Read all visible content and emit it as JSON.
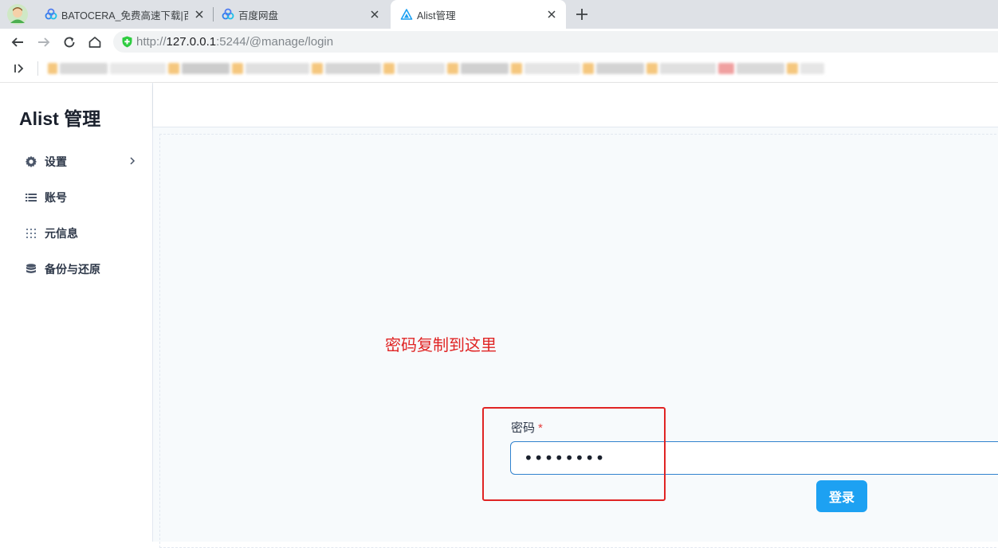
{
  "browser": {
    "tabs": [
      {
        "title": "BATOCERA_免费高速下载|百度",
        "icon": "baidu-netdisk-icon"
      },
      {
        "title": "百度网盘",
        "icon": "baidu-netdisk-icon"
      },
      {
        "title": "Alist管理",
        "icon": "alist-logo-icon"
      }
    ],
    "active_tab_index": 2,
    "url": {
      "scheme": "http://",
      "host": "127.0.0.1",
      "rest": ":5244/@manage/login"
    }
  },
  "sidebar": {
    "title": "Alist 管理",
    "items": [
      {
        "label": "设置",
        "icon": "gear-icon",
        "has_submenu": true
      },
      {
        "label": "账号",
        "icon": "list-icon"
      },
      {
        "label": "元信息",
        "icon": "grid-icon"
      },
      {
        "label": "备份与还原",
        "icon": "database-icon"
      }
    ]
  },
  "annotation": {
    "text": "密码复制到这里",
    "color": "#e02424"
  },
  "login": {
    "password_label": "密码",
    "required_mark": "*",
    "password_value": "••••••••",
    "submit_label": "登录"
  },
  "colors": {
    "accent": "#1da1f2",
    "focus_border": "#3182ce",
    "content_bg": "#f7fafc"
  }
}
